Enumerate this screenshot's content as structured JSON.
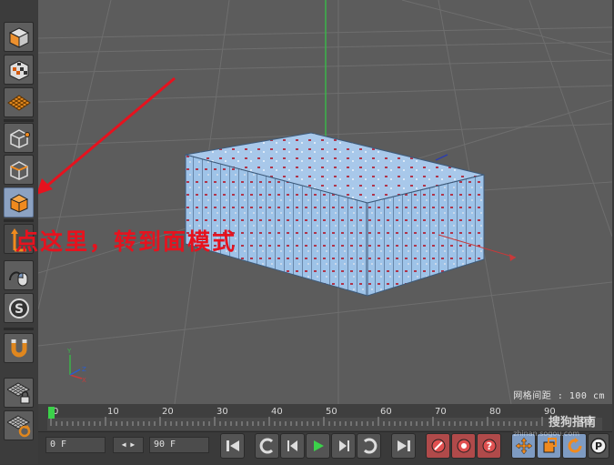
{
  "viewport": {
    "grid_spacing_readout": "网格间距 : 100 cm",
    "annotation_text": "点这里，转到面模式",
    "annotation_color": "#e6121e"
  },
  "sidebar": {
    "tools": [
      {
        "name": "make-editable-tool",
        "icon": "cube-icon"
      },
      {
        "name": "texture-mode-tool",
        "icon": "checker-cube-icon"
      },
      {
        "name": "workplane-mode-tool",
        "icon": "grid-plane-icon"
      },
      {
        "name": "points-mode-tool",
        "icon": "points-cube-icon"
      },
      {
        "name": "edges-mode-tool",
        "icon": "edges-cube-icon"
      },
      {
        "name": "polygons-mode-tool",
        "icon": "polygon-cube-icon",
        "active": true
      },
      {
        "name": "axis-mode-tool",
        "icon": "axis-icon"
      },
      {
        "name": "tweak-mode-tool",
        "icon": "mouse-icon"
      },
      {
        "name": "solo-tool",
        "icon": "solo-s-icon"
      },
      {
        "name": "snap-tool",
        "icon": "magnet-icon"
      },
      {
        "name": "workplane-lock-tool",
        "icon": "grid-lock-icon"
      },
      {
        "name": "workplane-align-tool",
        "icon": "grid-refresh-icon"
      }
    ]
  },
  "timeline": {
    "ticks": [
      "0",
      "10",
      "20",
      "30",
      "40",
      "50",
      "60",
      "70",
      "80",
      "90"
    ],
    "end_label": "0 F",
    "current_frame": 0
  },
  "transport": {
    "start_field": "0 F",
    "end_field": "90 F"
  },
  "watermark": {
    "text": "搜狗指南",
    "subtext": "zhinan.sogou.com"
  }
}
